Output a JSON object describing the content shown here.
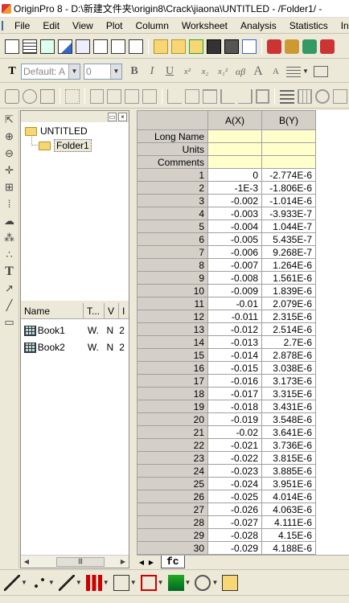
{
  "window": {
    "title": "OriginPro 8 - D:\\新建文件夹\\origin8\\Crack\\jiaona\\UNTITLED - /Folder1/ -"
  },
  "menu": [
    "File",
    "Edit",
    "View",
    "Plot",
    "Column",
    "Worksheet",
    "Analysis",
    "Statistics",
    "In"
  ],
  "format_toolbar": {
    "font_value": "Default: A",
    "size_value": "0",
    "buttons": [
      "B",
      "I",
      "U",
      "x²",
      "x₂",
      "x₁²",
      "αβ",
      "A",
      "A"
    ]
  },
  "explorer": {
    "root": "UNTITLED",
    "child": "Folder1",
    "columns": [
      "Name",
      "T...",
      "V",
      "I"
    ],
    "items": [
      {
        "name": "Book1",
        "type": "W.",
        "view": "N",
        "i": "2"
      },
      {
        "name": "Book2",
        "type": "W.",
        "view": "N",
        "i": "2"
      }
    ]
  },
  "worksheet": {
    "columns": [
      "A(X)",
      "B(Y)"
    ],
    "meta_rows": [
      "Long Name",
      "Units",
      "Comments"
    ],
    "rows": [
      {
        "n": "1",
        "a": "0",
        "b": "-2.774E-6"
      },
      {
        "n": "2",
        "a": "-1E-3",
        "b": "-1.806E-6"
      },
      {
        "n": "3",
        "a": "-0.002",
        "b": "-1.014E-6"
      },
      {
        "n": "4",
        "a": "-0.003",
        "b": "-3.933E-7"
      },
      {
        "n": "5",
        "a": "-0.004",
        "b": "1.044E-7"
      },
      {
        "n": "6",
        "a": "-0.005",
        "b": "5.435E-7"
      },
      {
        "n": "7",
        "a": "-0.006",
        "b": "9.268E-7"
      },
      {
        "n": "8",
        "a": "-0.007",
        "b": "1.264E-6"
      },
      {
        "n": "9",
        "a": "-0.008",
        "b": "1.561E-6"
      },
      {
        "n": "10",
        "a": "-0.009",
        "b": "1.839E-6"
      },
      {
        "n": "11",
        "a": "-0.01",
        "b": "2.079E-6"
      },
      {
        "n": "12",
        "a": "-0.011",
        "b": "2.315E-6"
      },
      {
        "n": "13",
        "a": "-0.012",
        "b": "2.514E-6"
      },
      {
        "n": "14",
        "a": "-0.013",
        "b": "2.7E-6"
      },
      {
        "n": "15",
        "a": "-0.014",
        "b": "2.878E-6"
      },
      {
        "n": "16",
        "a": "-0.015",
        "b": "3.038E-6"
      },
      {
        "n": "17",
        "a": "-0.016",
        "b": "3.173E-6"
      },
      {
        "n": "18",
        "a": "-0.017",
        "b": "3.315E-6"
      },
      {
        "n": "19",
        "a": "-0.018",
        "b": "3.431E-6"
      },
      {
        "n": "20",
        "a": "-0.019",
        "b": "3.548E-6"
      },
      {
        "n": "21",
        "a": "-0.02",
        "b": "3.641E-6"
      },
      {
        "n": "22",
        "a": "-0.021",
        "b": "3.736E-6"
      },
      {
        "n": "23",
        "a": "-0.022",
        "b": "3.815E-6"
      },
      {
        "n": "24",
        "a": "-0.023",
        "b": "3.885E-6"
      },
      {
        "n": "25",
        "a": "-0.024",
        "b": "3.951E-6"
      },
      {
        "n": "26",
        "a": "-0.025",
        "b": "4.014E-6"
      },
      {
        "n": "27",
        "a": "-0.026",
        "b": "4.063E-6"
      },
      {
        "n": "28",
        "a": "-0.027",
        "b": "4.111E-6"
      },
      {
        "n": "29",
        "a": "-0.028",
        "b": "4.15E-6"
      },
      {
        "n": "30",
        "a": "-0.029",
        "b": "4.188E-6"
      }
    ],
    "sheet_tab": "fc"
  }
}
